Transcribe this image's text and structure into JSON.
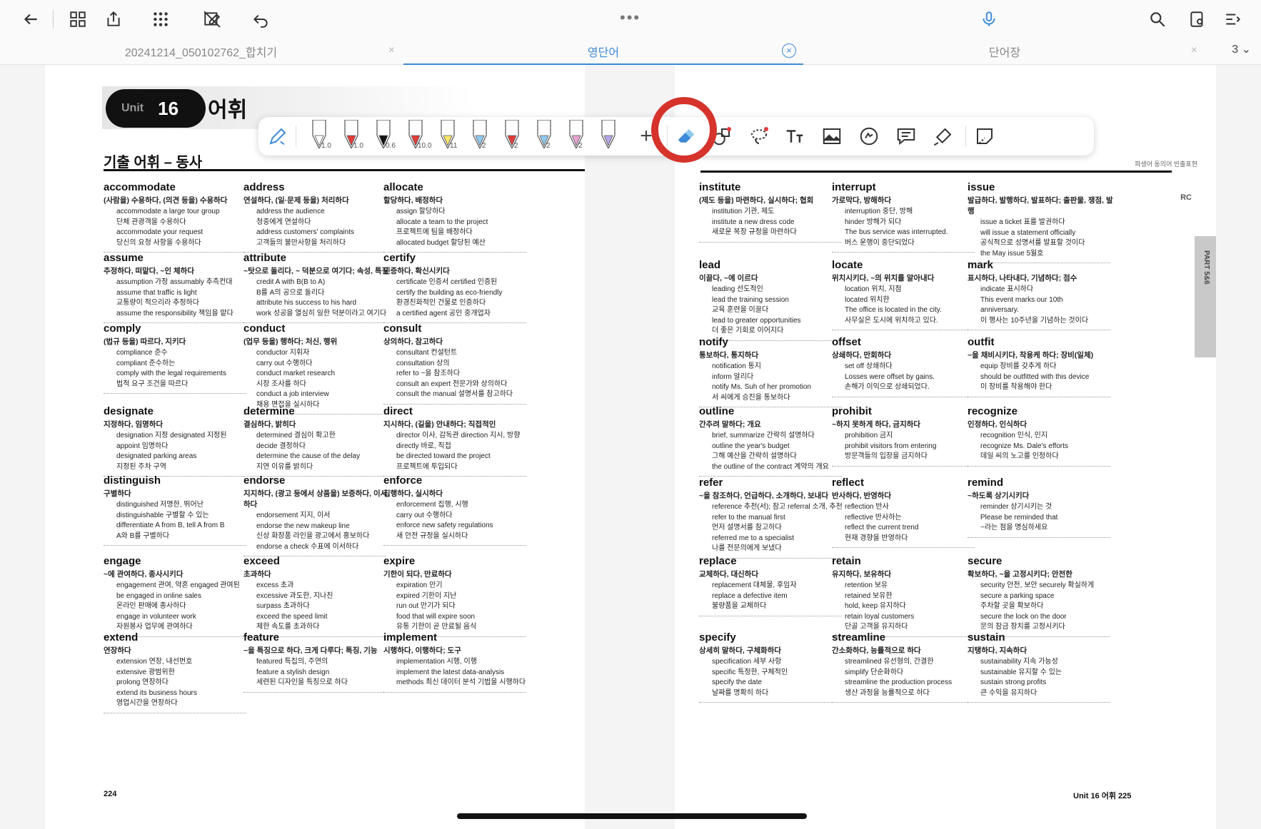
{
  "toolbar": {
    "back": "back-icon",
    "grid": "grid-icon",
    "share": "share-icon",
    "apps": "apps-icon",
    "no_edit": "no-edit-icon",
    "undo": "undo-icon",
    "more": "•••",
    "mic": "microphone-icon",
    "search": "search-icon",
    "settings": "settings-icon",
    "menu": "menu-icon"
  },
  "tabs": [
    {
      "label": "20241214_050102762_합치기",
      "close": "×"
    },
    {
      "label": "영단어",
      "close": "×"
    },
    {
      "label": "단어장",
      "close": "×"
    }
  ],
  "page_count": "3 ⌄",
  "pen_toolbar": {
    "pens": [
      {
        "size": "1.0",
        "color": "#ffffff"
      },
      {
        "size": "1.0",
        "color": "#e23b3b"
      },
      {
        "size": "0.6",
        "color": "#111111"
      },
      {
        "size": "10.0",
        "color": "#e23b3b"
      },
      {
        "size": "11",
        "color": "#f7e36a"
      },
      {
        "size": "2",
        "color": "#8ec9ef"
      },
      {
        "size": "2",
        "color": "#e23b3b"
      },
      {
        "size": "2",
        "color": "#8ec9ef"
      },
      {
        "size": "2",
        "color": "#e8a2d0"
      },
      {
        "size": "",
        "color": "#b6a6e8"
      }
    ],
    "add": "+"
  },
  "left_page": {
    "unit_word": "Unit",
    "unit_num": "16",
    "unit_title": "어휘",
    "section_title": "기출 어휘 – 동사",
    "page_number": "224",
    "columns": [
      [
        {
          "word": "accommodate",
          "meaning": "(사람을) 수용하다, (의견 등을) 수용하다",
          "lines": [
            "accommodate a large tour group",
            "단체 관광객을 수용하다",
            "accommodate your request",
            "당신의 요청 사항을 수용하다"
          ]
        },
        {
          "word": "assume",
          "meaning": "추정하다, 떠맡다, ~인 체하다",
          "lines": [
            "assumption 가정  assumably 추측컨대",
            "assume that traffic is light",
            "교통량이 적으리라 추정하다",
            "assume the responsibility 책임을 맡다"
          ]
        },
        {
          "word": "comply",
          "meaning": "(법규 등을) 따르다, 지키다",
          "lines": [
            "compliance 준수",
            "compliant 준수하는",
            "comply with the legal requirements",
            "법적 요구 조건을 따르다"
          ]
        },
        {
          "word": "designate",
          "meaning": "지정하다, 임명하다",
          "lines": [
            "designation 지정  designated 지정된",
            "appoint 임명하다",
            "designated parking areas",
            "지정된 주차 구역"
          ]
        },
        {
          "word": "distinguish",
          "meaning": "구별하다",
          "lines": [
            "distinguished 저명한, 뛰어난",
            "distinguishable 구별할 수 있는",
            "differentiate A from B, tell A from B",
            "A와 B를 구별하다"
          ]
        },
        {
          "word": "engage",
          "meaning": "~에 관여하다, 종사시키다",
          "lines": [
            "engagement 관여, 약혼  engaged 관여된",
            "be engaged in online sales",
            "온라인 판매에 종사하다",
            "engage in volunteer work",
            "자원봉사 업무에 관여하다"
          ]
        },
        {
          "word": "extend",
          "meaning": "연장하다",
          "lines": [
            "extension 연장, 내선번호",
            "extensive 광범위한",
            "prolong 연장하다",
            "extend its business hours",
            "영업시간을 연장하다"
          ]
        }
      ],
      [
        {
          "word": "address",
          "meaning": "연설하다, (일·문제 등을) 처리하다",
          "lines": [
            "address the audience",
            "청중에게 연설하다",
            "address customers' complaints",
            "고객들의 불만사항을 처리하다"
          ]
        },
        {
          "word": "attribute",
          "meaning": "~탓으로 돌리다, ~ 덕분으로 여기다; 속성, 특질",
          "lines": [
            "credit A with B(B to A)",
            "B를 A의 공으로 돌리다",
            "attribute his success to his hard",
            "work 성공을 열심히 일한 덕분이라고 여기다"
          ]
        },
        {
          "word": "conduct",
          "meaning": "(업무 등을) 행하다; 처신, 행위",
          "lines": [
            "conductor 지휘자",
            "carry out 수행하다",
            "conduct market research",
            "시장 조사를 하다",
            "conduct a job interview",
            "채용 면접을 실시하다"
          ]
        },
        {
          "word": "determine",
          "meaning": "결심하다, 밝히다",
          "lines": [
            "determined 결심이 확고한",
            "decide 결정하다",
            "determine the cause of the delay",
            "지연 이유를 밝히다"
          ]
        },
        {
          "word": "endorse",
          "meaning": "지지하다, (광고 등에서 상품을) 보증하다, 이서하다",
          "lines": [
            "endorsement 지지, 이서",
            "endorse the new makeup line",
            "신상 화장품 라인을 광고에서 홍보하다",
            "endorse a check 수표에 이서하다"
          ]
        },
        {
          "word": "exceed",
          "meaning": "초과하다",
          "lines": [
            "excess 초과",
            "excessive 과도한, 지나친",
            "surpass 초과하다",
            "exceed the speed limit",
            "제한 속도를 초과하다"
          ]
        },
        {
          "word": "feature",
          "meaning": "~을 특징으로 하다, 크게 다루다; 특징, 기능",
          "lines": [
            "featured 특집의, 주연의",
            "feature a stylish design",
            "세련된 디자인을 특징으로 하다"
          ]
        }
      ],
      [
        {
          "word": "allocate",
          "meaning": "할당하다, 배정하다",
          "lines": [
            "assign 할당하다",
            "allocate a team to the project",
            "프로젝트에 팀을 배정하다",
            "allocated budget 할당된 예산"
          ]
        },
        {
          "word": "certify",
          "meaning": "인증하다, 확신시키다",
          "lines": [
            "certificate 인증서  certified 인증된",
            "certify the building as eco-friendly",
            "환경친화적인 건물로 인증하다",
            "a certified agent 공인 중개업자"
          ]
        },
        {
          "word": "consult",
          "meaning": "상의하다, 참고하다",
          "lines": [
            "consultant 컨설턴트",
            "consultation 상의",
            "refer to ~을 참조하다",
            "consult an expert 전문가와 상의하다",
            "consult the manual 설명서를 참고하다"
          ]
        },
        {
          "word": "direct",
          "meaning": "지시하다, (길을) 안내하다; 직접적인",
          "lines": [
            "director 이사, 감독관  direction 지시, 방향",
            "directly 바로, 직접",
            "be directed toward the project",
            "프로젝트에 투입되다"
          ]
        },
        {
          "word": "enforce",
          "meaning": "집행하다, 실시하다",
          "lines": [
            "enforcement 집행, 시행",
            "carry out 수행하다",
            "enforce new safety regulations",
            "새 안전 규정을 실시하다"
          ]
        },
        {
          "word": "expire",
          "meaning": "기한이 되다, 만료하다",
          "lines": [
            "expiration 만기",
            "expired 기한이 지난",
            "run out 만기가 되다",
            "food that will expire soon",
            "유통 기한이 곧 만료될 음식"
          ]
        },
        {
          "word": "implement",
          "meaning": "시행하다, 이행하다; 도구",
          "lines": [
            "implementation 시행, 이행",
            "implement the latest data-analysis",
            "methods 최신 데이터 분석 기법을 시행하다"
          ]
        }
      ]
    ]
  },
  "right_page": {
    "legend": "파생어   동의어   빈출표현",
    "rc_tag": "RC",
    "part_tab": "PART 5&6",
    "page_number": "Unit 16  어휘   225",
    "columns": [
      [
        {
          "word": "institute",
          "meaning": "(제도 등을) 마련하다, 실시하다; 협회",
          "lines": [
            "institution 기관, 제도",
            "institute a new dress code",
            "새로운 복장 규정을 마련하다"
          ]
        },
        {
          "word": "lead",
          "meaning": "이끌다, ~에 이르다",
          "lines": [
            "leading 선도적인",
            "lead the training session",
            "교육 훈련을 이끌다",
            "lead to greater opportunities",
            "더 좋은 기회로 이어지다"
          ]
        },
        {
          "word": "notify",
          "meaning": "통보하다, 통지하다",
          "lines": [
            "notification 통지",
            "inform 알리다",
            "notify Ms. Suh of her promotion",
            "서 씨에게 승진을 통보하다"
          ]
        },
        {
          "word": "outline",
          "meaning": "간추려 말하다; 개요",
          "lines": [
            "brief, summarize 간략히 설명하다",
            "outline the year's budget",
            "그해 예산을 간략히 설명하다",
            "the outline of the contract 계약의 개요"
          ]
        },
        {
          "word": "refer",
          "meaning": "~을 참조하다, 언급하다, 소개하다, 보내다",
          "lines": [
            "reference 추천(서); 참고  referral 소개, 추천",
            "refer to the manual first",
            "먼저 설명서를 참고하다",
            "referred me to a specialist",
            "나를 전문의에게 보냈다"
          ]
        },
        {
          "word": "replace",
          "meaning": "교체하다, 대신하다",
          "lines": [
            "replacement 대체물, 후임자",
            "replace a defective item",
            "불량품을 교체하다"
          ]
        },
        {
          "word": "specify",
          "meaning": "상세히 말하다, 구체화하다",
          "lines": [
            "specification 세부 사항",
            "specific 특정한, 구체적인",
            "specify the date",
            "날짜를 명확히 하다"
          ]
        }
      ],
      [
        {
          "word": "interrupt",
          "meaning": "가로막다, 방해하다",
          "lines": [
            "interruption 중단, 방해",
            "hinder 방해가 되다",
            "The bus service was interrupted.",
            "버스 운행이 중단되었다"
          ]
        },
        {
          "word": "locate",
          "meaning": "위치시키다, ~의 위치를 알아내다",
          "lines": [
            "location 위치, 지점",
            "located 위치한",
            "The office is located in the city.",
            "사무실은 도시에 위치하고 있다."
          ]
        },
        {
          "word": "offset",
          "meaning": "상쇄하다, 만회하다",
          "lines": [
            "set off 상쇄하다",
            "Losses were offset by gains.",
            "손해가 이익으로 상쇄되었다."
          ]
        },
        {
          "word": "prohibit",
          "meaning": "~하지 못하게 하다, 금지하다",
          "lines": [
            "prohibition 금지",
            "prohibit visitors from entering",
            "방문객들의 입장을 금지하다"
          ]
        },
        {
          "word": "reflect",
          "meaning": "반사하다, 반영하다",
          "lines": [
            "reflection 반사",
            "reflective 반사하는",
            "reflect the current trend",
            "현재 경향을 반영하다"
          ]
        },
        {
          "word": "retain",
          "meaning": "유지하다, 보유하다",
          "lines": [
            "retention 보유",
            "retained 보유한",
            "hold, keep 유지하다",
            "retain loyal customers",
            "단골 고객을 유지하다"
          ]
        },
        {
          "word": "streamline",
          "meaning": "간소화하다, 능률적으로 하다",
          "lines": [
            "streamlined 유선형의, 간결한",
            "simplify 단순화하다",
            "streamline the production process",
            "생산 과정을 능률적으로 하다"
          ]
        }
      ],
      [
        {
          "word": "issue",
          "meaning": "발급하다, 발행하다, 발표하다; 출판물, 쟁점, 발행",
          "lines": [
            "issue a ticket 표를 발권하다",
            "will issue a statement officially",
            "공식적으로 성명서를 발표할 것이다",
            "the May issue 5월호"
          ]
        },
        {
          "word": "mark",
          "meaning": "표시하다, 나타내다, 기념하다; 점수",
          "lines": [
            "indicate 표시하다",
            "This event marks our 10th",
            "anniversary.",
            "이 행사는 10주년을 기념하는 것이다"
          ]
        },
        {
          "word": "outfit",
          "meaning": "~을 채비시키다, 착용케 하다; 장비(일체)",
          "lines": [
            "equip 장비를 갖추게 하다",
            "should be outfitted with this device",
            "이 장비를 착용해야 한다"
          ]
        },
        {
          "word": "recognize",
          "meaning": "인정하다, 인식하다",
          "lines": [
            "recognition 인식, 인지",
            "recognize Ms. Dale's efforts",
            "데일 씨의 노고를 인정하다"
          ]
        },
        {
          "word": "remind",
          "meaning": "~하도록 상기시키다",
          "lines": [
            "reminder 상기시키는 것",
            "Please be reminded that",
            "~라는 점을 명심하세요"
          ]
        },
        {
          "word": "secure",
          "meaning": "확보하다, ~을 고정시키다; 안전한",
          "lines": [
            "security 안전, 보안  securely 확실하게",
            "secure a parking space",
            "주차할 곳을 확보하다",
            "secure the lock on the door",
            "문의 잠금 장치를 고정시키다"
          ]
        },
        {
          "word": "sustain",
          "meaning": "지탱하다, 지속하다",
          "lines": [
            "sustainability 지속 가능성",
            "sustainable 유지할 수 있는",
            "sustain strong profits",
            "큰 수익을 유지하다"
          ]
        }
      ]
    ]
  }
}
